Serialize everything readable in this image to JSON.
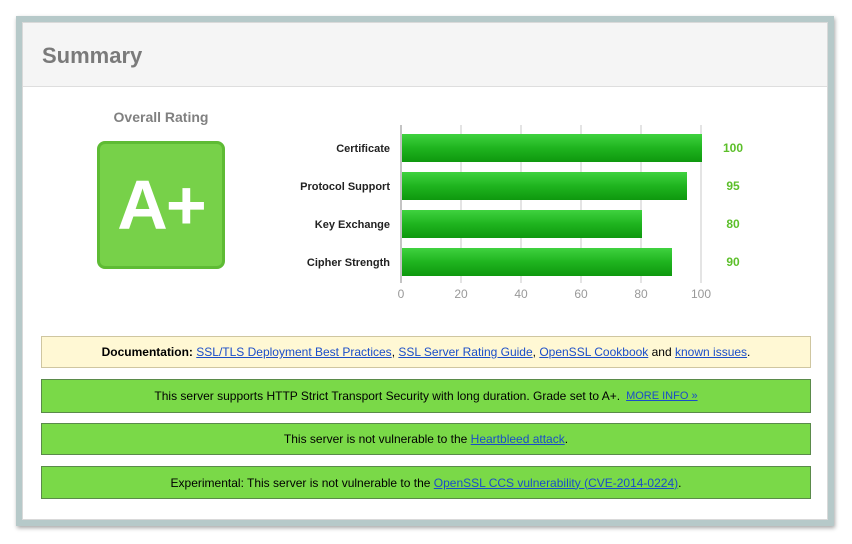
{
  "summary": {
    "title": "Summary"
  },
  "rating": {
    "label": "Overall Rating",
    "grade": "A+"
  },
  "chart_data": {
    "type": "bar",
    "orientation": "horizontal",
    "categories": [
      "Certificate",
      "Protocol Support",
      "Key Exchange",
      "Cipher Strength"
    ],
    "values": [
      100,
      95,
      80,
      90
    ],
    "xlim": [
      0,
      100
    ],
    "xticks": [
      "0",
      "20",
      "40",
      "60",
      "80",
      "100"
    ],
    "grid": true,
    "bar_color": "#22b422",
    "value_label_color": "#5cbf2a"
  },
  "notices": {
    "documentation": {
      "prefix": "Documentation: ",
      "link1": "SSL/TLS Deployment Best Practices",
      "sep1": ", ",
      "link2": "SSL Server Rating Guide",
      "sep2": ", ",
      "link3": "OpenSSL Cookbook",
      "sep3": " and ",
      "link4": "known issues",
      "suffix": "."
    },
    "hsts": {
      "text": "This server supports HTTP Strict Transport Security with long duration. Grade set to A+.",
      "link": "MORE INFO »"
    },
    "heartbleed": {
      "prefix": "This server is not vulnerable to the ",
      "link": "Heartbleed attack",
      "suffix": "."
    },
    "ccs": {
      "prefix": "Experimental: This server is not vulnerable to the ",
      "link": "OpenSSL CCS vulnerability (CVE-2014-0224)",
      "suffix": "."
    }
  },
  "colors": {
    "grade_bg": "#77d149",
    "green_notice": "#7ad948",
    "doc_notice": "#fff8d4",
    "link": "#1a4dc9"
  }
}
